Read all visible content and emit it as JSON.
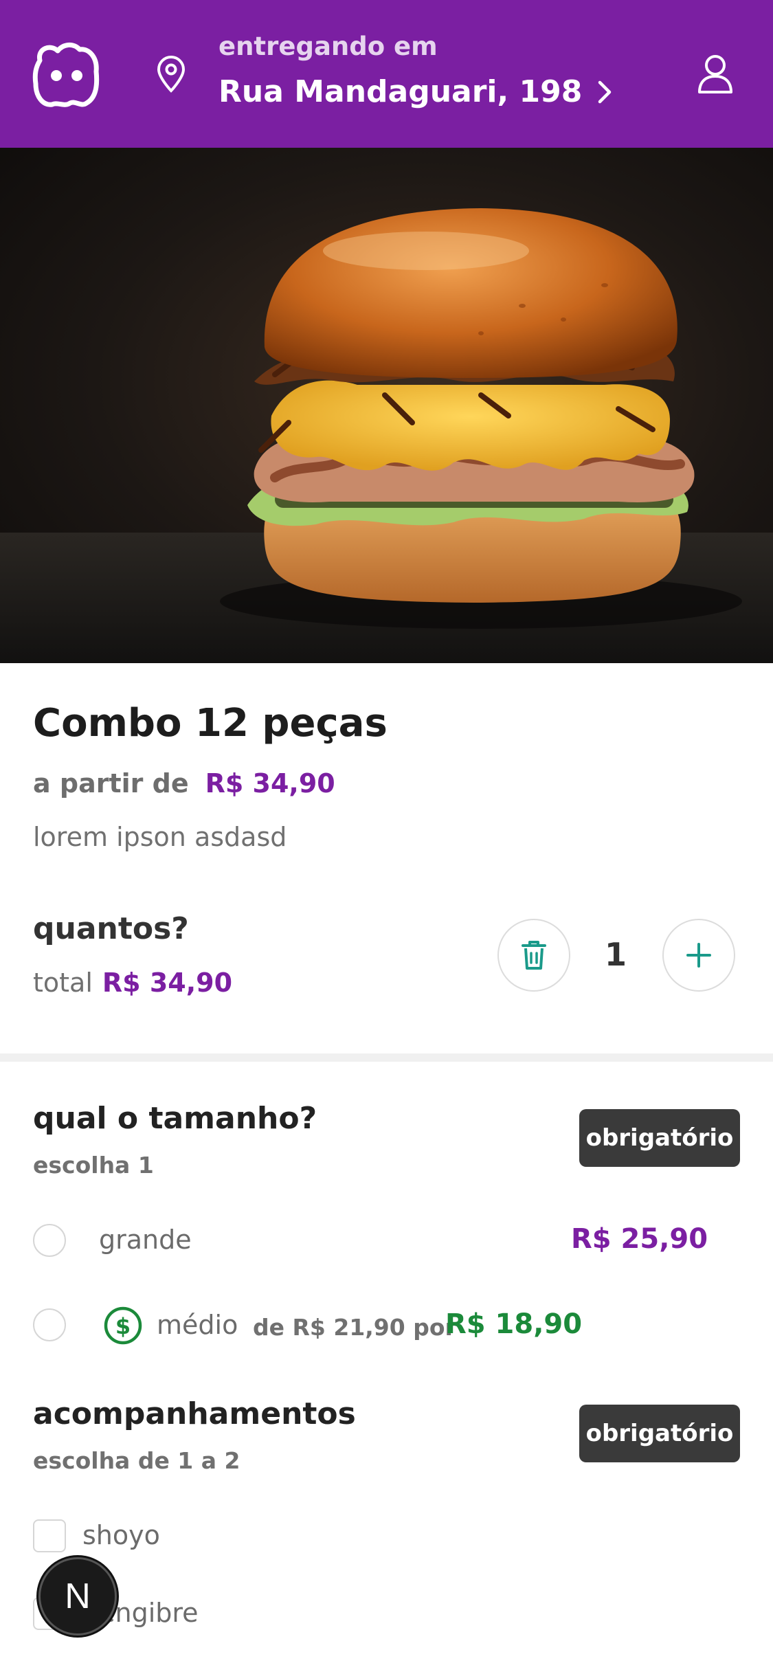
{
  "header": {
    "deliver_label": "entregando em",
    "address": "Rua Mandaguari, 198",
    "brand_color": "#7b1fa2",
    "icons": [
      "logo-icon",
      "location-pin-icon",
      "chevron-right-icon",
      "user-icon"
    ]
  },
  "product": {
    "title": "Combo 12 peças",
    "price_prefix": "a partir de",
    "price": "R$ 34,90",
    "description": "lorem ipson asdasd"
  },
  "quantity": {
    "title": "quantos?",
    "total_label": "total",
    "total_value": "R$ 34,90",
    "value": "1"
  },
  "size_group": {
    "title": "qual o tamanho?",
    "subtitle": "escolha 1",
    "badge": "obrigatório",
    "options": [
      {
        "label": "grande",
        "price": "R$ 25,90"
      },
      {
        "label": "médio",
        "old_price": "de R$ 21,90 por",
        "price": "R$ 18,90"
      }
    ]
  },
  "sides_group": {
    "title": "acompanhamentos",
    "subtitle": "escolha de 1 a 2",
    "badge": "obrigatório",
    "options": [
      {
        "label": "shoyo"
      },
      {
        "label": "gengibre"
      }
    ]
  },
  "fab": {
    "label": "N"
  },
  "colors": {
    "accent": "#7b1fa2",
    "promo": "#1b8a3a",
    "teal": "#1a9a8a",
    "badge_bg": "#3a3a3a"
  }
}
